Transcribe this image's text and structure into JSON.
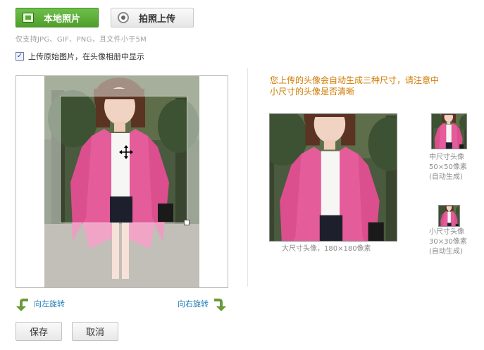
{
  "toolbar": {
    "local_photo_label": "本地照片",
    "camera_label": "拍照上传"
  },
  "hint": "仅支持JPG、GIF、PNG，且文件小于5M",
  "option": {
    "checked": true,
    "label": "上传原始图片，在头像相册中显示"
  },
  "notice": "您上传的头像会自动生成三种尺寸，请注意中小尺寸的头像是否清晰",
  "previews": {
    "large_caption": "大尺寸头像，180×180像素",
    "medium_caption": "中尺寸头像 50×50像素 (自动生成)",
    "small_caption": "小尺寸头像 30×30像素 (自动生成)"
  },
  "rotate": {
    "left_label": "向左旋转",
    "right_label": "向右旋转"
  },
  "actions": {
    "save_label": "保存",
    "cancel_label": "取消"
  },
  "colors": {
    "primary_button": "#5aaa36",
    "notice_text": "#d07a00",
    "link": "#1f7bb8",
    "rotate_arrow": "#6a9a3a"
  },
  "icons": {
    "local_photo": "image-upload-icon",
    "camera": "webcam-icon",
    "move": "move-cursor-icon",
    "rotate_left": "rotate-left-arrow-icon",
    "rotate_right": "rotate-right-arrow-icon"
  }
}
